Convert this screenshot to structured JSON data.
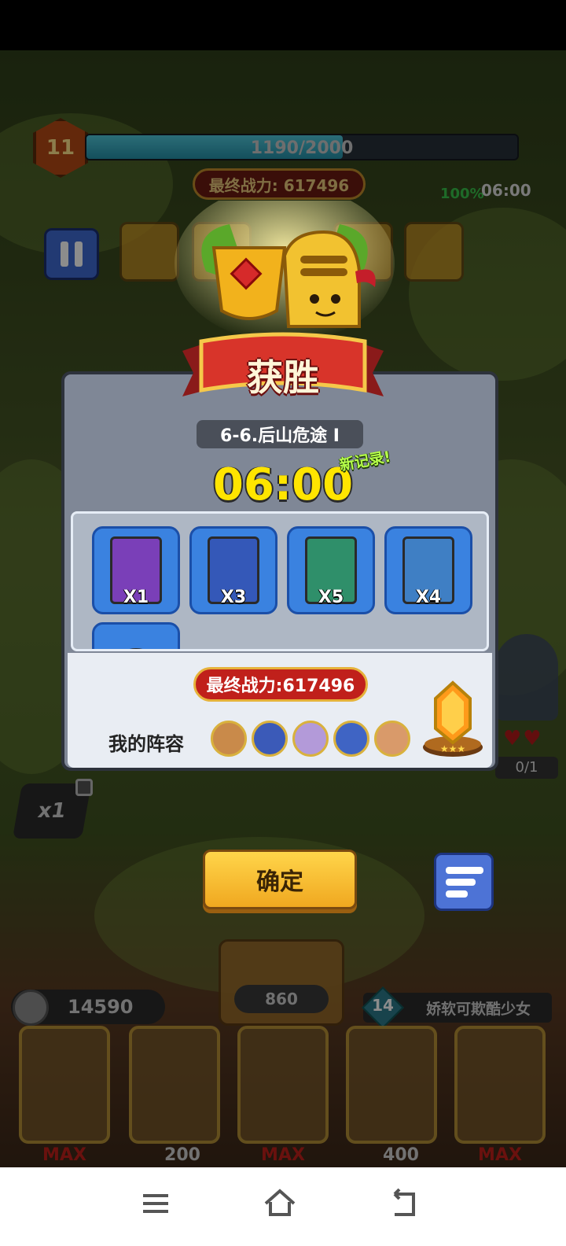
{
  "hud": {
    "level": "11",
    "xp_text": "1190/2000",
    "xp_fraction": 0.595,
    "power_text": "最终战力: 617496",
    "speed_pct": "100%",
    "timer": "06:00",
    "speed_multiplier": "x1",
    "enemy_count": "0/1"
  },
  "dialog": {
    "title": "获胜",
    "stage": "6-6.后山危途 I",
    "time": "06:00",
    "new_record": "新记录!",
    "rewards": [
      {
        "qty": "X1",
        "color": "#7a3fb8"
      },
      {
        "qty": "X3",
        "color": "#3458b8"
      },
      {
        "qty": "X5",
        "color": "#2f8f6a"
      },
      {
        "qty": "X4",
        "color": "#3f7fc4"
      },
      {
        "qty": "",
        "color": "#d9a52a"
      }
    ],
    "final_power": "最终战力:617496",
    "lineup_label": "我的阵容",
    "lineup_avatars": [
      "#c98a4a",
      "#3b5ab8",
      "#b39ad9",
      "#3f64c4",
      "#d99a6a"
    ]
  },
  "buttons": {
    "confirm": "确定"
  },
  "bottom": {
    "coins": "14590",
    "center_cost": "860",
    "hero_level": "14",
    "hero_name": "娇软可欺酷少女",
    "cards": [
      {
        "label": "MAX",
        "type": "max"
      },
      {
        "label": "200",
        "type": "cost"
      },
      {
        "label": "MAX",
        "type": "max"
      },
      {
        "label": "400",
        "type": "cost"
      },
      {
        "label": "MAX",
        "type": "max"
      }
    ]
  },
  "colors": {
    "victory_red": "#c0201b",
    "gold": "#ffe500",
    "panel": "#7f8796"
  }
}
